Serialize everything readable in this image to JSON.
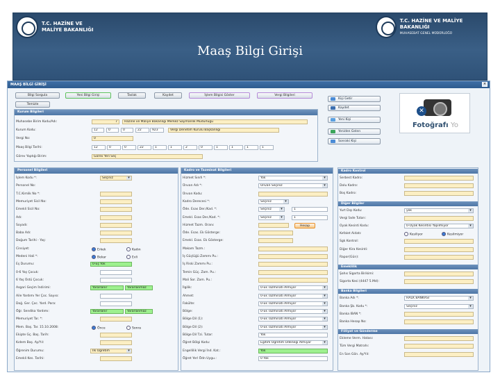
{
  "banner": {
    "left_line1": "T.C. HAZİNE VE",
    "left_line2": "MALİYE BAKANLIĞI",
    "right_line1": "T.C. HAZİNE VE MALİYE BAKANLIĞI",
    "right_line2": "MUHASEBAT GENEL MÜDÜRLÜĞÜ",
    "title": "Maaş Bilgi Girişi"
  },
  "window": {
    "title": "MAAŞ BİLGİ GİRİŞİ",
    "close": "×"
  },
  "toolbar": {
    "b1": "Bilgi Sorgula",
    "b2": "Yeni Bilgi Girişi",
    "b3": "Taslak",
    "b4": "Kaydet",
    "b5": "İşlem Bilgisi Göster",
    "b6": "Vergi Bilgileri",
    "b7": "Temizle"
  },
  "side": {
    "s1": "Kişi Getir",
    "s2": "Kaydet",
    "s3": "Yeni Kişi",
    "s4": "Yeniden Gelen",
    "s5": "Sonraki Kişi"
  },
  "photo": {
    "main": "Fotoğrafı",
    "ghost": "Yo"
  },
  "kurum": {
    "head": "Kurum Bilgileri",
    "l1": "Muhasebe Birim Kodu/Adı:",
    "v1a": "7",
    "v1b": "Hazine ve Maliye Bakanlığı Merkez Saymanlık Müdürlüğü",
    "l2": "Kurum Kodu:",
    "c2": [
      "12",
      "0",
      "0",
      "22",
      "923"
    ],
    "v2": "Vergi Denetim Kurulu Başkanlığı",
    "l3": "Vergi No:",
    "v3": "0",
    "l4": "Maaş Bilgi Tarihi:",
    "c4": [
      "12",
      "0",
      "0",
      "22",
      "1",
      "1",
      "2",
      "0",
      "1",
      "1",
      "1",
      "1"
    ],
    "l5": "Görev Yaptığı Birim:",
    "v5": "Görev Yeri Seç"
  },
  "personel": {
    "head": "Personel Bilgileri",
    "l1": "İşlem Kodu *:",
    "v1": "Seçiniz",
    "l2": "Personel No:",
    "l3": "T.C.Kimlik No *:",
    "l4": "Memuriyet Sicil No:",
    "l5": "Emekli Sicil No:",
    "l6": "Adı:",
    "l7": "Soyadı:",
    "l8": "Baba Adı:",
    "l9": "Doğum Tarihi - Yaş:",
    "l10": "Cinsiyet:",
    "r10a": "Erkek",
    "r10b": "Kadın",
    "l11": "Medeni Hali *:",
    "r11a": "Bekar",
    "r11b": "Evli",
    "l12": "Eş Durumu:",
    "v12": "0-Eş Yok",
    "l13": "0-6 Yaş Çocuk:",
    "l14": "6 Yaş Üstü Çocuk:",
    "l15": "Asgari Geçim İndirimi:",
    "v15a": "Yararlanır",
    "v15b": "Yararlanmaz",
    "l16": "Aile Yardımı Yer Çoc. Sayısı:",
    "l17": "Doğ. Ger. Çoc. Yard. Para:",
    "l18": "Öğr. Sendika Yardımı:",
    "v18a": "Yararlanır",
    "v18b": "Yararlanmaz",
    "l19": "Memuriyet Tar. *:",
    "l20": "Mem. Baş. Tar. 15.10.2008:",
    "r20a": "Önce",
    "r20b": "Sonra",
    "l21": "Ekipte Gç. Baş. Tarih:",
    "l22": "Kıdem Baş. Ay/Yıl:",
    "l23": "Öğrenim Durumu:",
    "v23": "İlk Öğretim",
    "l24": "Emekli Kes. Tarihi:"
  },
  "kadro": {
    "head": "Kadro ve Tazminat Bilgileri",
    "l1": "Hizmet Sınıfı *:",
    "v1": "Yok",
    "l2": "Ünvan Adı *:",
    "v2": "Ünvan Seçiniz",
    "l3": "Ünvan Kodu:",
    "l4": "Kadro Derecesi *:",
    "v4": "Seçiniz",
    "l5": "Öde. Esas Der./Kad. *:",
    "v5a": "Seçiniz",
    "v5b": "1",
    "l6": "Emekl. Esas Der./Kad. *:",
    "v6a": "Seçiniz",
    "v6b": "1",
    "l7": "Hizmet Tazm. Oranı:",
    "b7": "Hesap",
    "l8": "Öde. Esas. Ek Gösterge:",
    "l9": "Emekl. Esas. Ek Gösterge:",
    "l10": "Makam Tazm.:",
    "l11": "İş Güçlüğü Zammı Pu.:",
    "l12": "İş Riski Zammı Pu.:",
    "l13": "Temin Güç. Zam. Pu.:",
    "l14": "Mali Sor. Zam. Pu.:",
    "l15": "İlgilik:",
    "v15": "0-Ek Tazminatı Almıyor",
    "l16": "Ahmet:",
    "v16": "0-Ek Tazminatı Almıyor",
    "l17": "Fakülte:",
    "v17": "0-Ek Tazminatı Almıyor",
    "l18": "Bölge:",
    "v18": "0-Ek Tazminatı Almıyor",
    "l19": "Bölge Dil (1):",
    "v19": "0-Ek Tazminatı Almıyor",
    "l20": "Bölge Dil (2):",
    "v20": "0-Ek Tazminatı Almıyor",
    "l21": "Bölge Dil Tzi. Tutar:",
    "v21": "Yok",
    "l22": "Öğret Bölgi Kodu:",
    "v22": "Eğitim Öğretim Ödeneği Almıyor",
    "l23": "Engellilik Vergi İnd. Kat.:",
    "v23": "Yok",
    "l24": "Öğret Yerl Ödn Uygu.:",
    "v24": "0 Yok"
  },
  "kk": {
    "head": "Kadro Kontrol",
    "l1": "Serbest Kadro:",
    "l2": "Dolu Kadro:",
    "l3": "Boş Kadro:"
  },
  "diger": {
    "head": "Diğer Bilgiler",
    "l1": "Yurt Dışı Kodu:",
    "v1": "yok",
    "l2": "Vergi İade Tutarı:",
    "l3": "Oyak Kesinti Kodu:",
    "v3": "0-Oyak Kesintisi Yapılmıyor",
    "l4": "Kefalet Aidatı:",
    "r4a": "Kesiliyor",
    "r4b": "Kesilmiyor",
    "l5": "Sgk Kontrol:",
    "l6": "Diğer Kira Kesinti:",
    "l7": "Rapor(Gün):"
  },
  "emeklilik": {
    "head": "Emeklilik",
    "l1": "Şahıs Sigorta Birikimi:",
    "l2": "Sigorta Kesi (4447 5.Md):"
  },
  "banka": {
    "head": "Banka Bilgileri",
    "l1": "Banka Adı *:",
    "v1": "HALK BANKASI",
    "l2": "Banka Şb. Kodu *:",
    "v2": "Seçiniz",
    "l3": "Banka IBAN *:",
    "l4": "Banka Hesap No:"
  },
  "fiiliyat": {
    "head": "Fiiliyat ve Gönderme",
    "l1": "Ekleme Verm. Hatası:",
    "l2": "Tüm Vergi Matrahı:",
    "l3": "En Son Gön. Ay/Yıl:"
  }
}
